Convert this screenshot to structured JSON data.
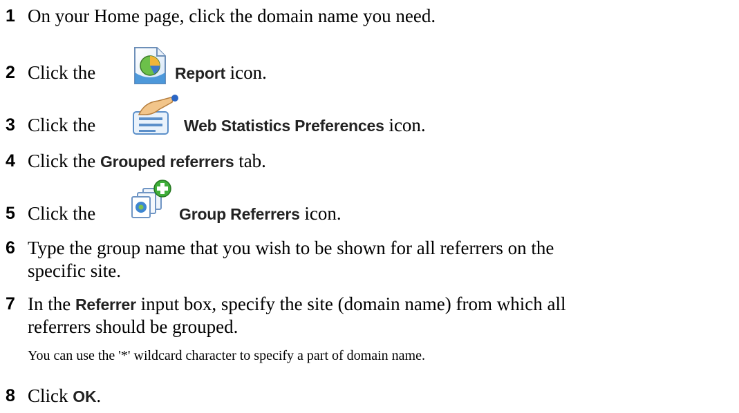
{
  "steps": [
    {
      "num": "1",
      "text_pre": "On your Home page, click the domain name you need."
    },
    {
      "num": "2",
      "text_pre": "Click the",
      "ui": "Report",
      "text_post": "icon.",
      "icon": "report-icon"
    },
    {
      "num": "3",
      "text_pre": "Click the",
      "ui": "Web Statistics Preferences",
      "text_post": "icon.",
      "icon": "preferences-icon"
    },
    {
      "num": "4",
      "text_pre": "Click the",
      "ui": "Grouped referrers",
      "text_post": "tab."
    },
    {
      "num": "5",
      "text_pre": "Click the",
      "ui": "Group Referrers",
      "text_post": "icon.",
      "icon": "group-referrers-icon"
    },
    {
      "num": "6",
      "text_line1": "Type the group name that you wish to be shown for all referrers on the",
      "text_line2": "specific site."
    },
    {
      "num": "7",
      "text_pre": "In the",
      "ui": "Referrer",
      "text_mid": "input box, specify the site (domain name) from which all",
      "text_line2": "referrers should be grouped."
    },
    {
      "num": "8",
      "text_pre": "Click",
      "ui": "OK",
      "text_post": "."
    }
  ],
  "note": "You can use the '*' wildcard character to specify a part of domain name."
}
